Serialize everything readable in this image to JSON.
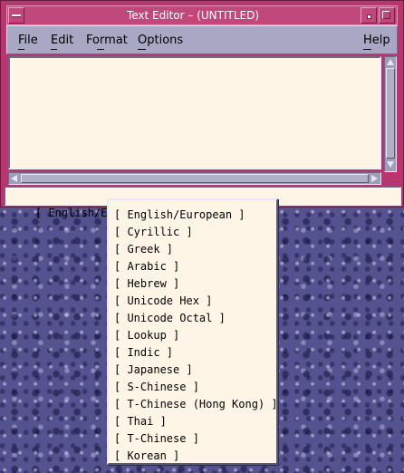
{
  "window": {
    "title": "Text Editor – (UNTITLED)"
  },
  "menubar": {
    "file": "File",
    "edit": "Edit",
    "format": "Format",
    "options": "Options",
    "help": "Help"
  },
  "statusbar": {
    "input_method": "[ English/European ]"
  },
  "input_method_menu": {
    "items": [
      "[ English/European ]",
      "[ Cyrillic ]",
      "[ Greek ]",
      "[ Arabic ]",
      "[ Hebrew ]",
      "[ Unicode Hex ]",
      "[ Unicode Octal ]",
      "[ Lookup ]",
      "[ Indic ]",
      "[ Japanese ]",
      "[ S-Chinese ]",
      "[ T-Chinese (Hong Kong) ]",
      "[ Thai ]",
      "[ T-Chinese ]",
      "[ Korean ]"
    ]
  }
}
